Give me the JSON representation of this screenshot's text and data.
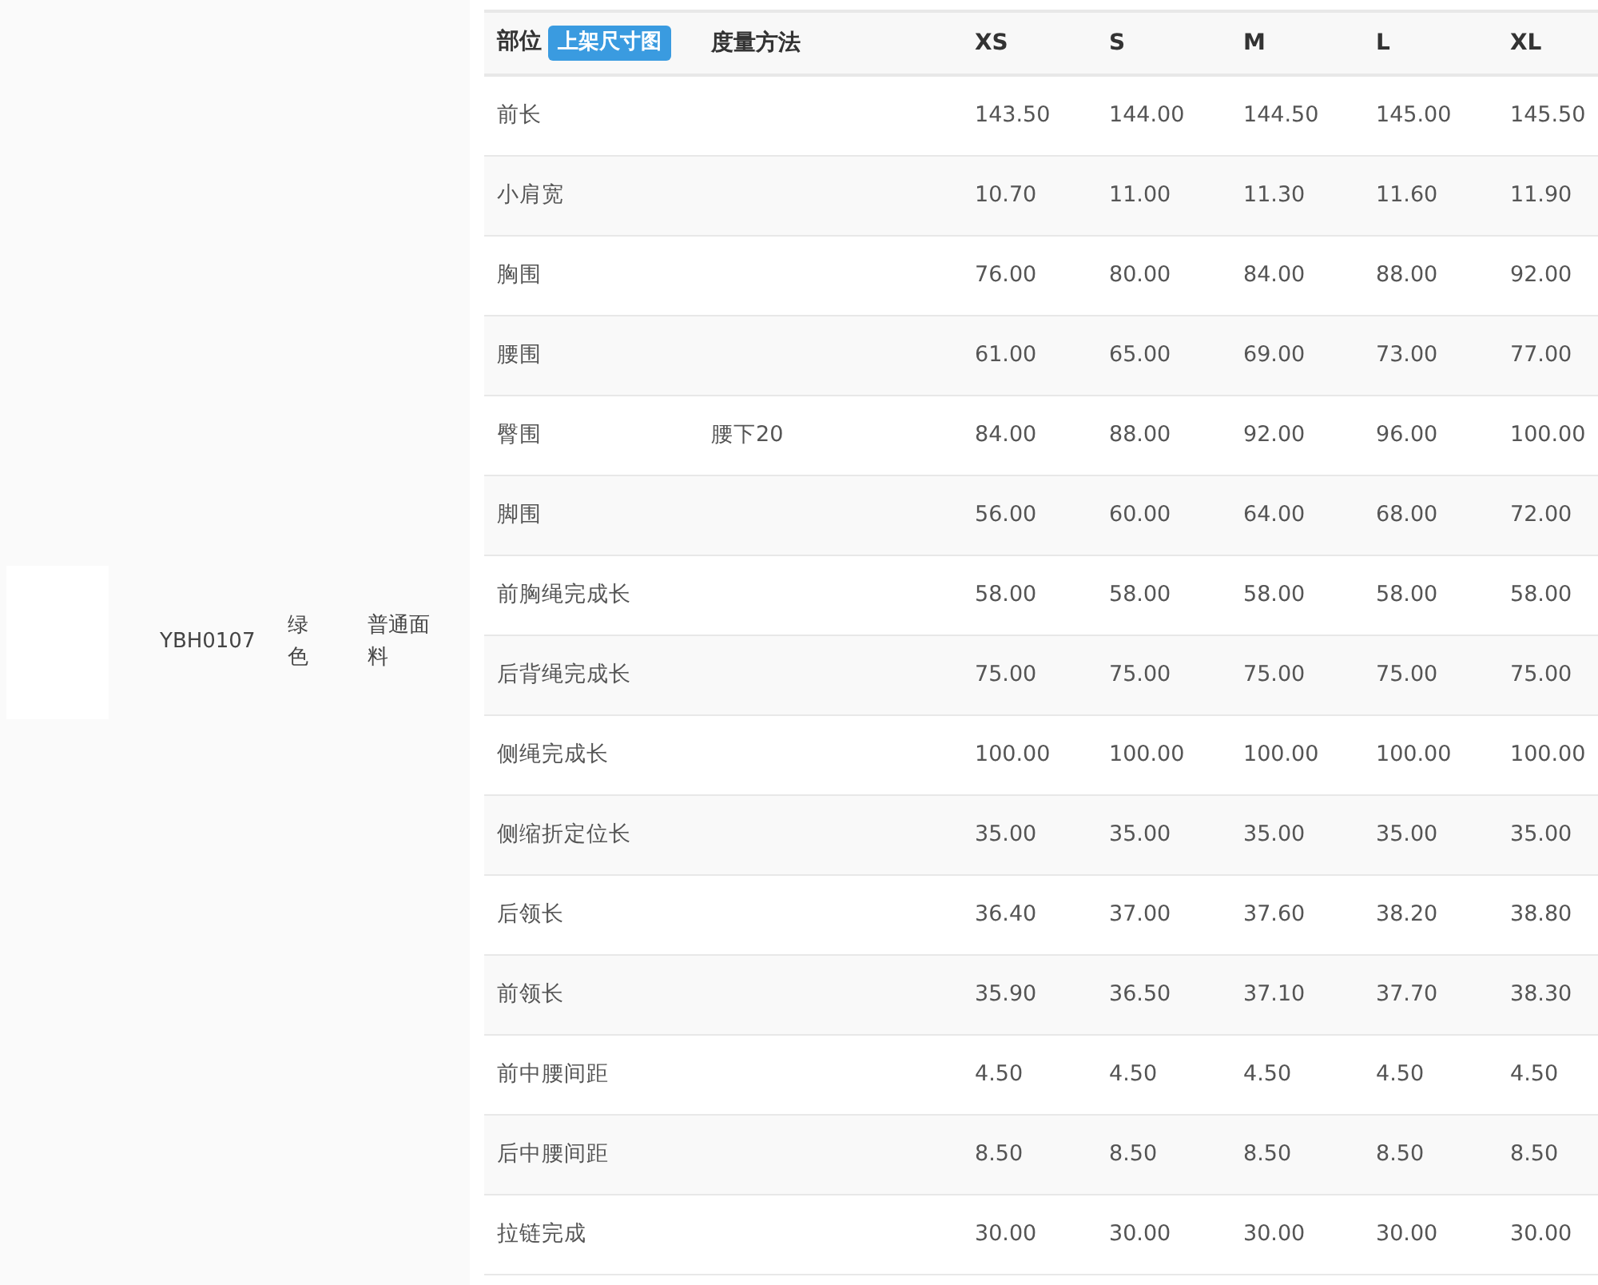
{
  "product": {
    "code": "YBH0107",
    "color_label": "绿色",
    "fabric": "普通面料"
  },
  "size_table": {
    "columns": [
      {
        "label": "部位",
        "badge": "上架尺寸图"
      },
      {
        "label": "度量方法"
      },
      {
        "label": "XS"
      },
      {
        "label": "S"
      },
      {
        "label": "M"
      },
      {
        "label": "L"
      },
      {
        "label": "XL"
      }
    ],
    "rows": [
      [
        "前长",
        "",
        "143.50",
        "144.00",
        "144.50",
        "145.00",
        "145.50"
      ],
      [
        "小肩宽",
        "",
        "10.70",
        "11.00",
        "11.30",
        "11.60",
        "11.90"
      ],
      [
        "胸围",
        "",
        "76.00",
        "80.00",
        "84.00",
        "88.00",
        "92.00"
      ],
      [
        "腰围",
        "",
        "61.00",
        "65.00",
        "69.00",
        "73.00",
        "77.00"
      ],
      [
        "臀围",
        "腰下20",
        "84.00",
        "88.00",
        "92.00",
        "96.00",
        "100.00"
      ],
      [
        "脚围",
        "",
        "56.00",
        "60.00",
        "64.00",
        "68.00",
        "72.00"
      ],
      [
        "前胸绳完成长",
        "",
        "58.00",
        "58.00",
        "58.00",
        "58.00",
        "58.00"
      ],
      [
        "后背绳完成长",
        "",
        "75.00",
        "75.00",
        "75.00",
        "75.00",
        "75.00"
      ],
      [
        "侧绳完成长",
        "",
        "100.00",
        "100.00",
        "100.00",
        "100.00",
        "100.00"
      ],
      [
        "侧缩折定位长",
        "",
        "35.00",
        "35.00",
        "35.00",
        "35.00",
        "35.00"
      ],
      [
        "后领长",
        "",
        "36.40",
        "37.00",
        "37.60",
        "38.20",
        "38.80"
      ],
      [
        "前领长",
        "",
        "35.90",
        "36.50",
        "37.10",
        "37.70",
        "38.30"
      ],
      [
        "前中腰间距",
        "",
        "4.50",
        "4.50",
        "4.50",
        "4.50",
        "4.50"
      ],
      [
        "后中腰间距",
        "",
        "8.50",
        "8.50",
        "8.50",
        "8.50",
        "8.50"
      ],
      [
        "拉链完成",
        "",
        "30.00",
        "30.00",
        "30.00",
        "30.00",
        "30.00"
      ]
    ]
  }
}
